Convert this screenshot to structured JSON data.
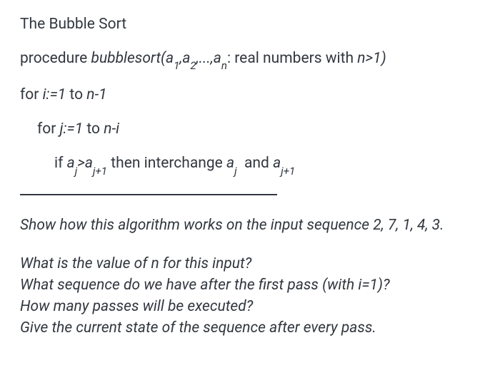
{
  "title": "The Bubble Sort",
  "proc": {
    "kw": "procedure ",
    "name": "bubblesort(a",
    "sub1": "1",
    "c1": ",a",
    "sub2": "2",
    "c2": ",...,a",
    "subn": "n",
    "tail": ": real numbers with ",
    "cond": "n>1)"
  },
  "outer": {
    "kw": "for ",
    "var": "i:=1",
    "to": " to ",
    "lim": "n-1"
  },
  "inner": {
    "kw": "for ",
    "var": "j:=1",
    "to": " to ",
    "lim": "n-i"
  },
  "ifline": {
    "kw": "if ",
    "a1": "a",
    "s1": "j",
    "gt": ">a",
    "s2": "j+1",
    "mid": " then interchange ",
    "a3": "a",
    "s3": "j",
    "sp": "  and ",
    "a4": "a",
    "s4": "j+1"
  },
  "q_intro": "Show how this algorithm works on the input sequence 2, 7, 1, 4, 3.",
  "q1": "What is the value of n for this input?",
  "q2": "What sequence do we have after the first pass (with i=1)?",
  "q3": "How many passes will be executed?",
  "q4": "Give the current state of the sequence after every pass."
}
